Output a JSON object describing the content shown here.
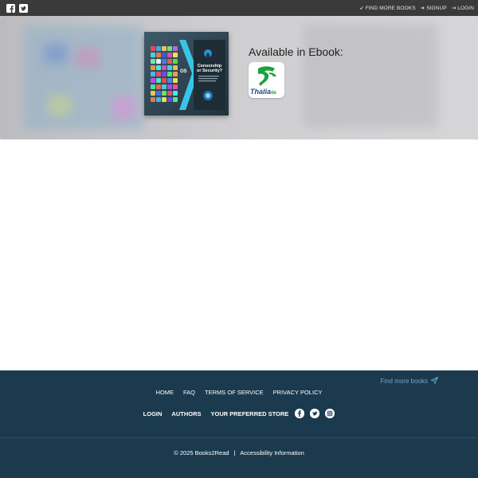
{
  "topbar": {
    "social_icons": [
      "facebook-square-icon",
      "twitter-square-icon"
    ],
    "find_more_label": "FIND MORE BOOKS",
    "signup_label": "SIGNUP",
    "login_label": "LOGIN"
  },
  "hero": {
    "available_label": "Available in Ebook:",
    "store": {
      "name": "Thalia",
      "suffix": "de"
    },
    "book": {
      "side_label": "OS",
      "cover_title_line1": "Censorship",
      "cover_title_line2": "or Security?"
    }
  },
  "footer": {
    "find_more_label": "Find more books",
    "links": [
      "HOME",
      "FAQ",
      "TERMS OF SERVICE",
      "PRIVACY POLICY"
    ],
    "links_bold": [
      "LOGIN",
      "AUTHORS",
      "YOUR PREFERRED STORE"
    ],
    "social_icons": [
      "facebook-icon",
      "twitter-icon",
      "instagram-icon"
    ],
    "copyright": "© 2025 Books2Read",
    "separator": "|",
    "accessibility": "Accessibility Information"
  },
  "colors": {
    "topbar": "#3a3a3a",
    "footer": "#1b3a4e",
    "accent_link": "#6fa8cc",
    "thalia_green": "#1aa33a"
  }
}
